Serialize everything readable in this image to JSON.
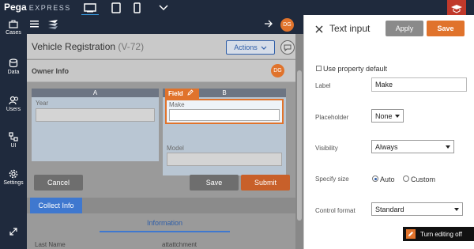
{
  "brand": {
    "name": "Pega",
    "sub": "EXPRESS"
  },
  "colors": {
    "accent": "#e0732c",
    "primary": "#3f78cf",
    "nav_bg": "#1f2a3d"
  },
  "topbar": {
    "devices": [
      "desktop-icon",
      "tablet-icon",
      "phone-icon"
    ]
  },
  "nav": {
    "items": [
      {
        "label": "Cases",
        "icon": "briefcase-icon"
      },
      {
        "label": "Data",
        "icon": "database-icon"
      },
      {
        "label": "Users",
        "icon": "users-icon"
      },
      {
        "label": "UI",
        "icon": "ui-icon"
      },
      {
        "label": "Settings",
        "icon": "gear-icon"
      }
    ]
  },
  "canvas": {
    "user_initials": "DG",
    "case_title": "Vehicle Registration",
    "case_id": "(V-72)",
    "actions_label": "Actions",
    "section_title": "Owner Info",
    "section_initials": "DG",
    "region_a": "A",
    "region_b": "B",
    "field_tag": "Field",
    "year_label": "Year",
    "make_label": "Make",
    "model_label": "Model",
    "cancel_label": "Cancel",
    "save_label": "Save",
    "submit_label": "Submit",
    "collect_tab": "Collect Info",
    "info_tab": "Information",
    "col_last_name": "Last Name",
    "col_attachment": "attattchment"
  },
  "panel": {
    "title": "Text input",
    "apply_label": "Apply",
    "save_label": "Save",
    "use_property_default": "Use property default",
    "label_caption": "Label",
    "label_value": "Make",
    "placeholder_caption": "Placeholder",
    "placeholder_value": "None",
    "visibility_caption": "Visibility",
    "visibility_value": "Always",
    "size_caption": "Specify size",
    "size_auto": "Auto",
    "size_custom": "Custom",
    "control_caption": "Control format",
    "control_value": "Standard"
  },
  "footer": {
    "turn_off_editing": "Turn editing off"
  }
}
